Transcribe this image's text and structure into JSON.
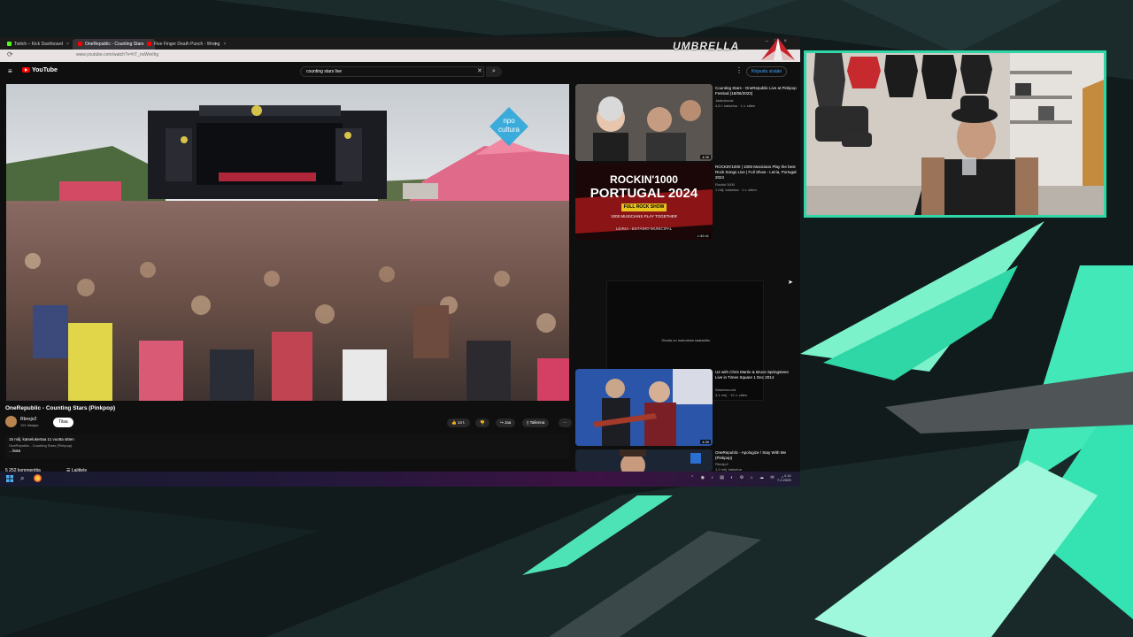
{
  "browser": {
    "tabs": [
      {
        "label": "Twitch – Kick Dashboard",
        "color": "#53fc18"
      },
      {
        "label": "OneRepublic - Counting Stars",
        "color": "#ff0000"
      },
      {
        "label": "Five Finger Death Punch - Wrong",
        "color": "#ff0000"
      }
    ],
    "url": "www.youtube.com/watch?v=hT_nvWreIhg",
    "overlay_brand": "UMBRELLA"
  },
  "youtube": {
    "logo": "YouTube",
    "search_query": "counting stars live",
    "signin_label": "Kirjaudu sisään",
    "video": {
      "watermark": "npo cultura",
      "title": "OneRepublic - Counting Stars (Pinkpop)",
      "channel": "Rbnxjo2",
      "subscribers": "191 tilaajaa",
      "join_label": "Tilaa",
      "likes": "14 t.",
      "share_label": "Jaa",
      "save_label": "Tallenna",
      "views_line": "15 milj. katselukertaa  11 vuotta sitten",
      "description": "OneRepublic - Counting Stars (Pinkpop)",
      "more_label": "...lisää",
      "comments_count": "5 252 kommenttia",
      "sort_label": "Lajittele"
    },
    "recommendations": [
      {
        "title": "Counting Stars - OneRepublic Live at Pinkpop Festival (18/06/2023)",
        "channel": "Jaakoboost",
        "meta": "4,8 t. katselua · 1 v. sitten",
        "duration": "4:35"
      },
      {
        "title": "ROCKIN'1000 | 1000 Musicians Play the best Rock Songs Live | Full Show - Leiria, Portugal 2024",
        "channel": "Rockin'1000",
        "meta": "1 milj. katselua · 1 v. sitten",
        "duration": "1:32:41",
        "thumb_headline": "ROCKIN'1000",
        "thumb_sub": "PORTUGAL 2024",
        "thumb_badge": "FULL ROCK SHOW",
        "thumb_note": "1000 MUSICIANS PLAY TOGETHER",
        "thumb_place": "LEIRIA - ESTÁDIO MUNICIPAL"
      },
      {
        "title": "U2 with Chris Martin & Bruce Springsteen Live in Times Square 1 Dec 2014",
        "channel": "Wasensound",
        "meta": "3,1 milj. · 10 v. sitten",
        "duration": "4:39"
      },
      {
        "title": "OneRepublic - Apologize / Stay With Me (Pinkpop)",
        "channel": "Rbnxjo2",
        "meta": "1,2 milj. katselua"
      }
    ],
    "ad_text": "Sivulla on mainoksia saatavilla."
  },
  "taskbar": {
    "tray": "⌃ ◉ ♪ ▤ ◐ ⚙ ⌂ ☁ ✉ ◔",
    "time": "4.14",
    "date": "7.2.2025"
  },
  "theme": {
    "accent": "#2fd6a6",
    "brand_red": "#ff0000",
    "link_blue": "#3ea6ff"
  }
}
